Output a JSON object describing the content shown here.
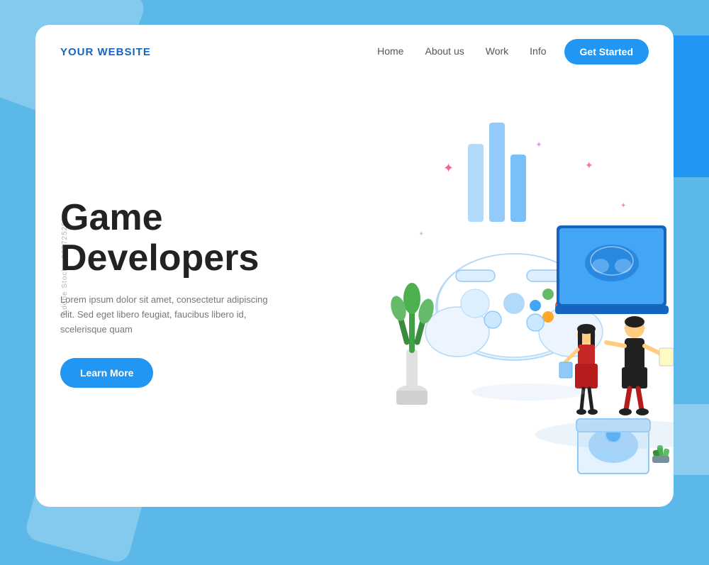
{
  "background": {
    "color": "#5bb8e8"
  },
  "navbar": {
    "logo": "YOUR WEBSITE",
    "links": [
      {
        "label": "Home",
        "href": "#"
      },
      {
        "label": "About us",
        "href": "#"
      },
      {
        "label": "Work",
        "href": "#"
      },
      {
        "label": "Info",
        "href": "#"
      }
    ],
    "cta_label": "Get Started"
  },
  "hero": {
    "title_line1": "Game",
    "title_line2": "Developers",
    "description": "Lorem ipsum dolor sit amet, consectetur adipiscing elit. Sed eget libero feugiat, faucibus libero id, scelerisque quam",
    "cta_label": "Learn More"
  },
  "watermark": {
    "text": "Adobe Stock · 287725252"
  }
}
